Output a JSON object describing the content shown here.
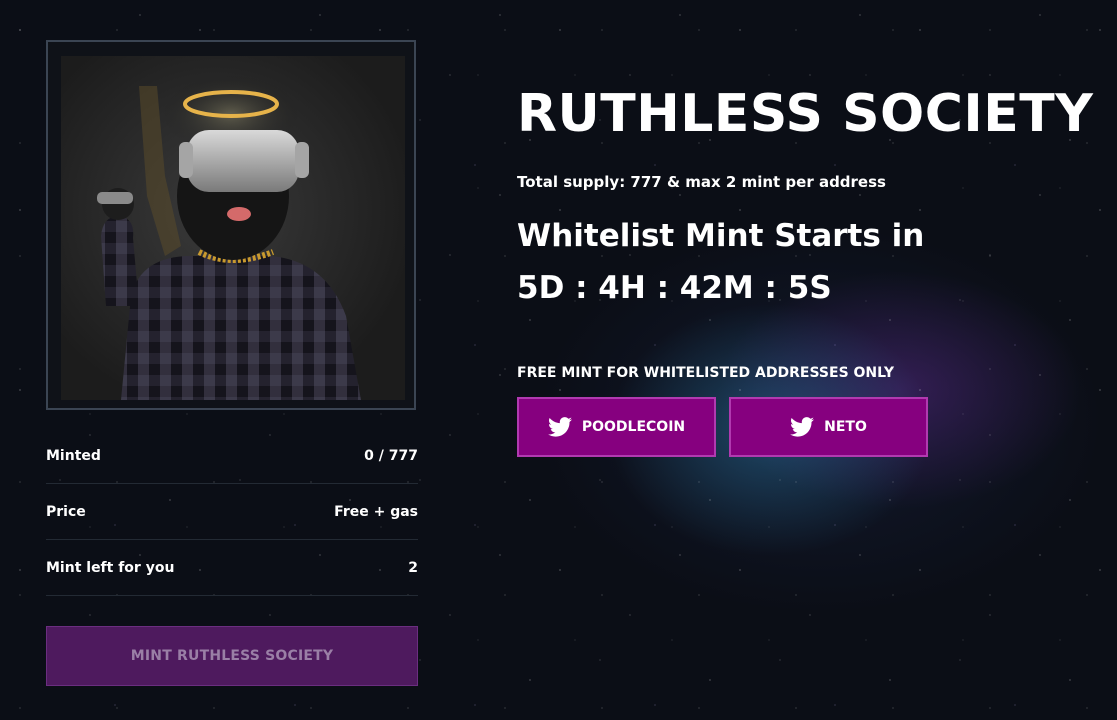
{
  "project": {
    "title": "RUTHLESS SOCIETY",
    "supply_text": "Total supply: 777 & max 2 mint per address",
    "whitelist_heading": "Whitelist Mint Starts in",
    "countdown": "5D : 4H : 42M : 5S",
    "free_mint_note": "FREE MINT FOR WHITELISTED ADDRESSES ONLY"
  },
  "socials": [
    {
      "label": "POODLECOIN",
      "icon": "twitter-icon"
    },
    {
      "label": "NETO",
      "icon": "twitter-icon"
    }
  ],
  "stats": [
    {
      "label": "Minted",
      "value": "0 / 777"
    },
    {
      "label": "Price",
      "value": "Free + gas"
    },
    {
      "label": "Mint left for you",
      "value": "2"
    }
  ],
  "mint_button": {
    "label": "MINT RUTHLESS SOCIETY",
    "disabled": true
  },
  "colors": {
    "background": "#0b0e16",
    "social_button": "#86007f",
    "mint_button": "#4e1a5e"
  }
}
